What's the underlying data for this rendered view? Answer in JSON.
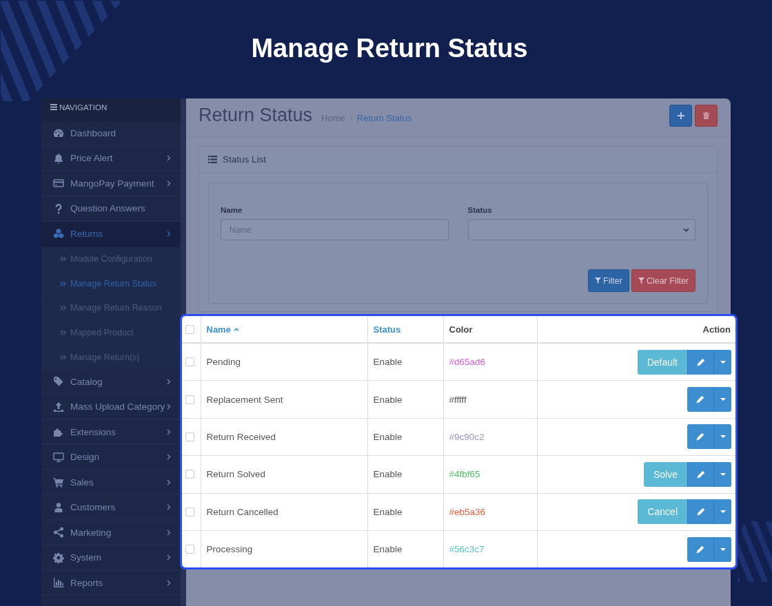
{
  "banner": {
    "title": "Manage Return Status"
  },
  "sidebar": {
    "heading": "NAVIGATION",
    "items": [
      {
        "label": "Dashboard",
        "submenu": false,
        "selected": false
      },
      {
        "label": "Price Alert",
        "submenu": true,
        "selected": false
      },
      {
        "label": "MangoPay Payment",
        "submenu": true,
        "selected": false
      },
      {
        "label": "Question Answers",
        "submenu": false,
        "selected": false
      },
      {
        "label": "Returns",
        "submenu": true,
        "selected": true,
        "expanded": true,
        "children": [
          {
            "label": "Module Configuration",
            "selected": false
          },
          {
            "label": "Manage Return Status",
            "selected": true
          },
          {
            "label": "Manage Return Reason",
            "selected": false
          },
          {
            "label": "Mapped Product",
            "selected": false
          },
          {
            "label": "Manage Return(s)",
            "selected": false
          }
        ]
      },
      {
        "label": "Catalog",
        "submenu": true,
        "selected": false
      },
      {
        "label": "Mass Upload Category",
        "submenu": true,
        "selected": false
      },
      {
        "label": "Extensions",
        "submenu": true,
        "selected": false
      },
      {
        "label": "Design",
        "submenu": true,
        "selected": false
      },
      {
        "label": "Sales",
        "submenu": true,
        "selected": false
      },
      {
        "label": "Customers",
        "submenu": true,
        "selected": false
      },
      {
        "label": "Marketing",
        "submenu": true,
        "selected": false
      },
      {
        "label": "System",
        "submenu": true,
        "selected": false
      },
      {
        "label": "Reports",
        "submenu": true,
        "selected": false
      }
    ]
  },
  "page": {
    "title": "Return Status",
    "breadcrumb": [
      {
        "label": "Home",
        "selected": false
      },
      {
        "label": "Return Status",
        "selected": true
      }
    ]
  },
  "panel": {
    "title": "Status List",
    "filters": [
      {
        "label": "Name",
        "kind": "text",
        "placeholder": "Name"
      },
      {
        "label": "Status",
        "kind": "select"
      }
    ],
    "buttons": [
      {
        "label": "Filter",
        "kind": "primary"
      },
      {
        "label": "Clear Filter",
        "kind": "danger"
      }
    ]
  },
  "table": {
    "select_all": {
      "checked": false
    },
    "columns": [
      {
        "label": "Name",
        "sortable": true,
        "sorted": true
      },
      {
        "label": "Status",
        "sortable": true,
        "sorted": false
      },
      {
        "label": "Color",
        "sortable": false,
        "sorted": false
      },
      {
        "label": "Action",
        "sortable": false,
        "sorted": false
      }
    ],
    "rows": [
      {
        "checked": false,
        "name": "Pending",
        "status": "Enable",
        "code": "#d65ad6",
        "color": "#d65ad6",
        "action": "Default"
      },
      {
        "checked": false,
        "name": "Replacement Sent",
        "status": "Enable",
        "code": "#fffff",
        "color": "#555555"
      },
      {
        "checked": false,
        "name": "Return Received",
        "status": "Enable",
        "code": "#9c90c2",
        "color": "#9c90c2"
      },
      {
        "checked": false,
        "name": "Return Solved",
        "status": "Enable",
        "code": "#4fbf65",
        "color": "#4fbf65",
        "action": "Solve"
      },
      {
        "checked": false,
        "name": "Return Cancelled",
        "status": "Enable",
        "code": "#eb5a36",
        "color": "#eb5a36",
        "action": "Cancel"
      },
      {
        "checked": false,
        "name": "Processing",
        "status": "Enable",
        "code": "#56c3c7",
        "color": "#56c3c7"
      }
    ]
  }
}
